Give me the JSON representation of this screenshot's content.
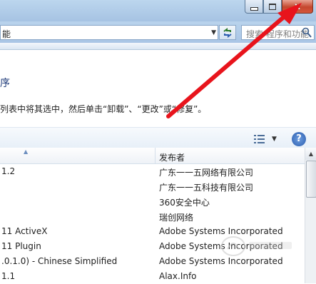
{
  "window": {
    "minimize_label": "minimize",
    "maximize_label": "maximize",
    "close_label": "x"
  },
  "address": {
    "text": "能",
    "search_placeholder": "搜索 程序和功能"
  },
  "page": {
    "heading": "序",
    "instruction": "列表中将其选中，然后单击“卸载”、“更改”或“修复”。"
  },
  "toolbar": {
    "help_label": "?"
  },
  "table": {
    "columns": [
      "",
      "发布者"
    ],
    "rows": [
      {
        "name": "1.2",
        "publisher": "广东一一五网络有限公司"
      },
      {
        "name": "",
        "publisher": "广东一一五科技有限公司"
      },
      {
        "name": "",
        "publisher": "360安全中心"
      },
      {
        "name": "",
        "publisher": "瑞创网络"
      },
      {
        "name": "11 ActiveX",
        "publisher": "Adobe Systems Incorporated"
      },
      {
        "name": "11 Plugin",
        "publisher": "Adobe Systems Incorporated"
      },
      {
        "name": ".0.1.0) - Chinese Simplified",
        "publisher": "Adobe Systems Incorporated"
      },
      {
        "name": "1.1",
        "publisher": "Alax.Info"
      }
    ]
  },
  "icons": {
    "refresh": "refresh-icon",
    "search": "search-icon",
    "view": "view-options-icon",
    "help": "help-icon"
  },
  "colors": {
    "arrow": "#e8141c",
    "chrome": "#a9c5e5",
    "close_button": "#c5472e"
  }
}
